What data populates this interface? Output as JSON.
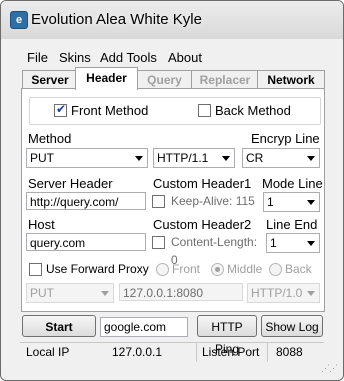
{
  "window": {
    "title": "Evolution Alea White Kyle",
    "icon": "app-icon"
  },
  "menu": [
    "File",
    "Skins",
    "Add Tools",
    "About"
  ],
  "tabs": [
    {
      "label": "Server",
      "state": "normal"
    },
    {
      "label": "Header",
      "state": "active"
    },
    {
      "label": "Query",
      "state": "disabled"
    },
    {
      "label": "Replacer",
      "state": "disabled"
    },
    {
      "label": "Network",
      "state": "normal"
    }
  ],
  "header": {
    "front_method": {
      "label": "Front Method",
      "checked": true
    },
    "back_method": {
      "label": "Back Method",
      "checked": false
    },
    "method": {
      "label": "Method",
      "value": "PUT"
    },
    "http_version": {
      "value": "HTTP/1.1"
    },
    "encrypt_line": {
      "label": "Encryp Line",
      "value": "CR"
    },
    "server_header": {
      "label": "Server Header",
      "value": "http://query.com/"
    },
    "custom_header1": {
      "label": "Custom Header1",
      "checked": false,
      "placeholder": "Keep-Alive: 115"
    },
    "mode_line": {
      "label": "Mode Line",
      "value": "1"
    },
    "host": {
      "label": "Host",
      "value": "query.com"
    },
    "custom_header2": {
      "label": "Custom Header2",
      "checked": false,
      "placeholder": "Content-Length: 0"
    },
    "line_end": {
      "label": "Line End",
      "value": "1"
    },
    "forward_proxy": {
      "label": "Use Forward Proxy",
      "checked": false,
      "options": [
        "Front",
        "Middle",
        "Back"
      ],
      "selected": "Middle",
      "method": "PUT",
      "address": "127.0.0.1:8080",
      "http_version": "HTTP/1.0"
    }
  },
  "actions": {
    "start": "Start",
    "host_input": "google.com",
    "http_ping": "HTTP Ping",
    "show_log": "Show Log"
  },
  "status": {
    "local_ip_label": "Local IP",
    "local_ip": "127.0.0.1",
    "listen_port_label": "Listen Port",
    "listen_port": "8088"
  }
}
